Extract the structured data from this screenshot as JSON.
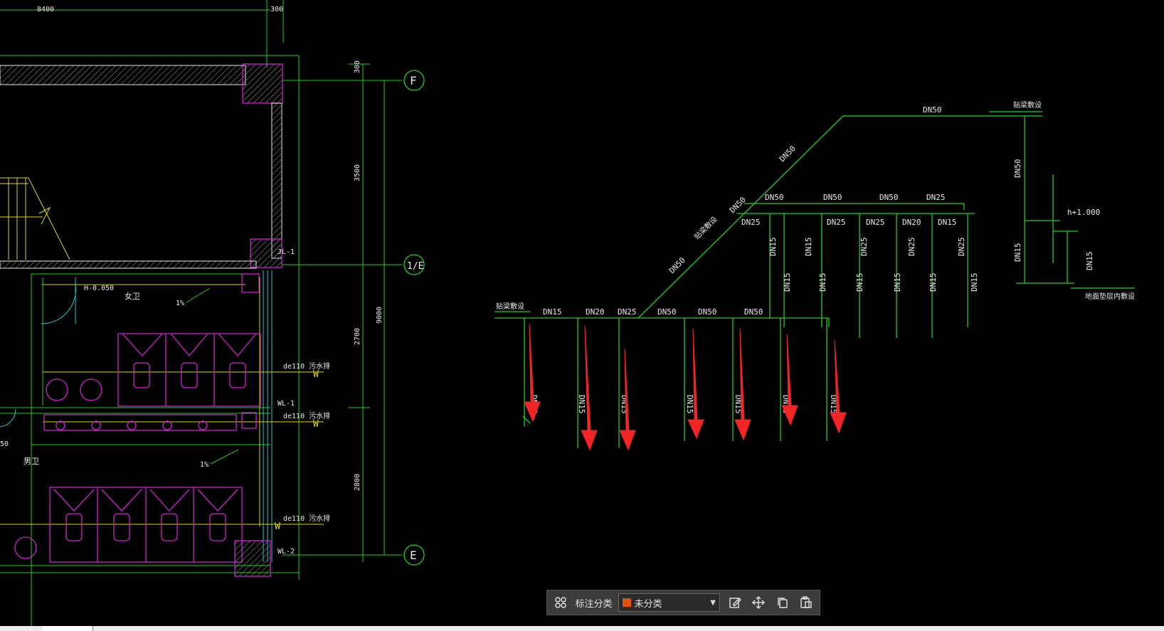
{
  "plan": {
    "dim_top_left": "8400",
    "dim_top_right": "300",
    "dim_v_300": "300",
    "dim_v_3500": "3500",
    "dim_v_2700": "2700",
    "dim_v_2800": "2800",
    "dim_v_9000": "9000",
    "grid_top": "F",
    "grid_mid": "1/E",
    "grid_bottom": "E",
    "tag_jl1": "JL-1",
    "tag_wl1": "WL-1",
    "tag_wl2": "WL-2",
    "level_mark": "H-0.050",
    "room_female": "女卫",
    "room_male": "男卫",
    "slope_1": "1%",
    "slope_2": "1%",
    "side_dim": "50",
    "pipe_labels": [
      "de110 污水排",
      "de110 污水排",
      "de110 污水排"
    ],
    "w_marks": [
      "W",
      "W",
      "W"
    ]
  },
  "system": {
    "top_main": "DN50",
    "top_left_label": "贴梁敷设",
    "diag_labels": [
      "DN50",
      "DN50",
      "DN50"
    ],
    "diag_note": "贴梁敷设",
    "upper_branch": [
      "DN50",
      "DN50",
      "DN50",
      "DN25"
    ],
    "upper_sub": [
      "DN25",
      "DN25",
      "DN25",
      "DN20",
      "DN15"
    ],
    "upper_risers": [
      "DN15",
      "DN15",
      "DN25",
      "DN25",
      "DN25"
    ],
    "upper_lower_risers": [
      "DN15",
      "DN15",
      "DN15",
      "DN15",
      "DN15",
      "DN15"
    ],
    "lower_main": [
      "DN15",
      "DN20",
      "DN25",
      "DN50",
      "DN50",
      "DN50"
    ],
    "lower_left_note": "贴梁敷设",
    "lower_risers": [
      "DN15",
      "DN15",
      "DN15",
      "DN15",
      "DN15",
      "DN15",
      "DN15"
    ],
    "right_riser_1": "DN50",
    "right_riser_2": "DN15",
    "right_riser_3": "DN15",
    "right_level": "h+1.000",
    "right_note": "地面垫层内敷设"
  },
  "toolbar": {
    "grid_icon": "grid-icon",
    "label": "标注分类",
    "selected": "未分类",
    "swatch_color": "#e0520f",
    "edit_icon": "edit-icon",
    "move_icon": "move-icon",
    "copy_icon": "copy-icon",
    "paste_icon": "paste-icon"
  },
  "colors": {
    "background": "#000000",
    "green": "#19d219",
    "magenta": "#d21cd2",
    "yellow": "#d8d81a",
    "cyan": "#19c9d2",
    "white": "#e8e8e8",
    "arrow_red": "#f02525"
  }
}
